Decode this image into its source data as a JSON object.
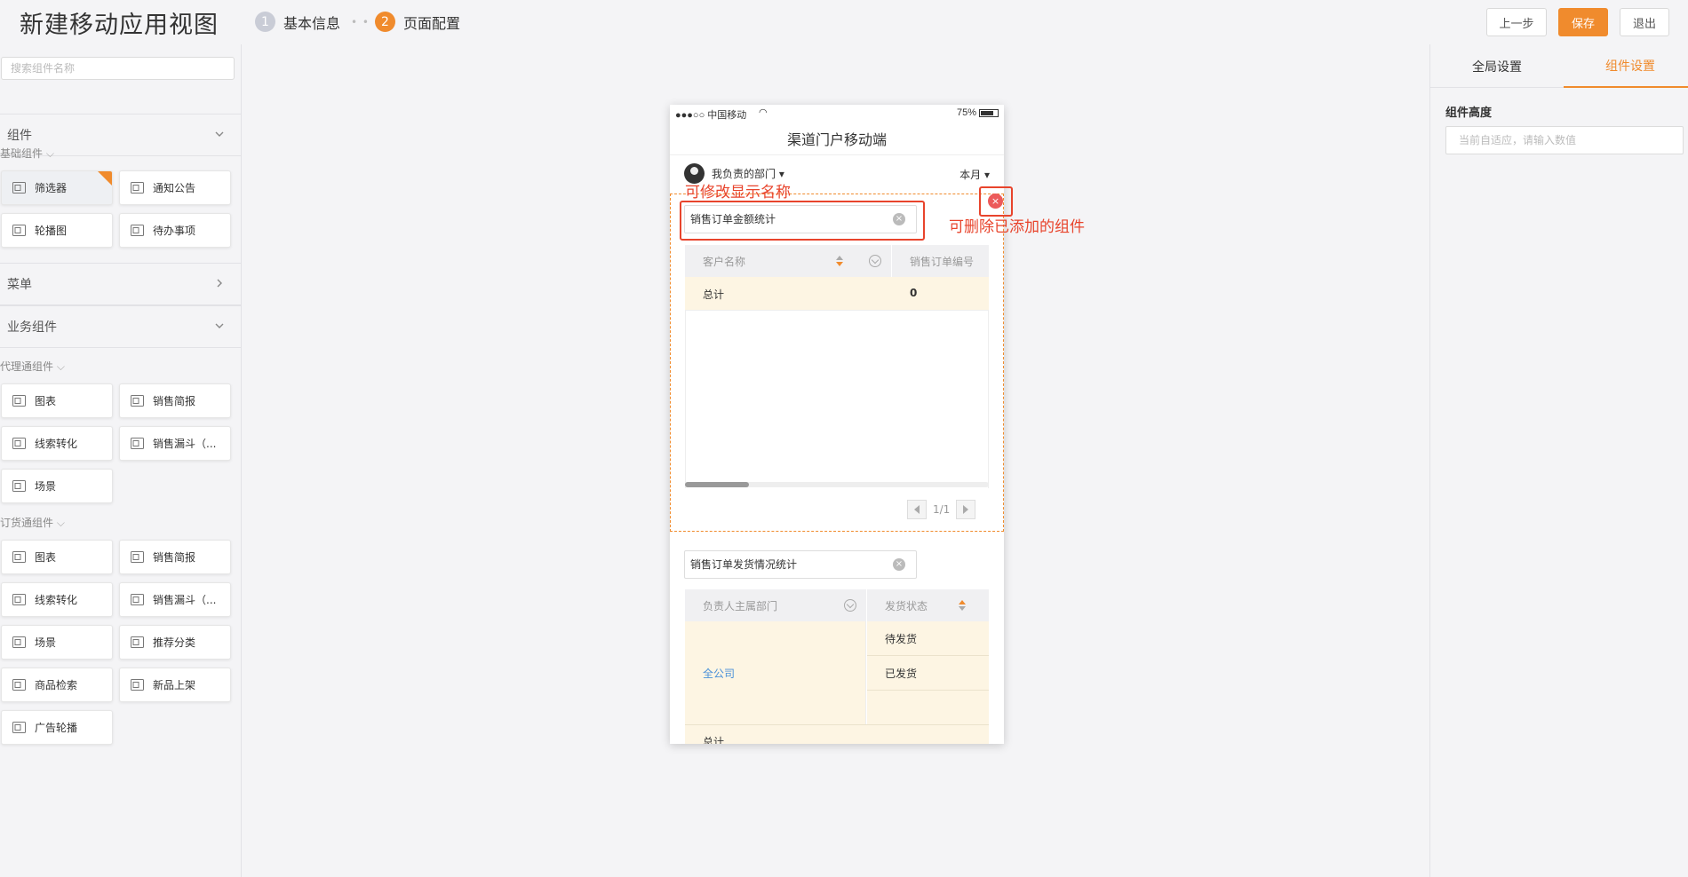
{
  "header": {
    "title": "新建移动应用视图",
    "steps": [
      {
        "num": "1",
        "label": "基本信息"
      },
      {
        "num": "2",
        "label": "页面配置"
      }
    ],
    "buttons": {
      "prev": "上一步",
      "save": "保存",
      "exit": "退出"
    }
  },
  "sidebar": {
    "search_placeholder": "搜索组件名称",
    "sections": {
      "components": "组件",
      "menu": "菜单",
      "business": "业务组件"
    },
    "groups": {
      "basic": "基础组件",
      "agent": "代理通组件",
      "order": "订货通组件"
    },
    "basic_items": [
      "筛选器",
      "通知公告",
      "轮播图",
      "待办事项"
    ],
    "agent_items": [
      "图表",
      "销售简报",
      "线索转化",
      "销售漏斗（...",
      "场景"
    ],
    "order_items": [
      "图表",
      "销售简报",
      "线索转化",
      "销售漏斗（...",
      "场景",
      "推荐分类",
      "商品检索",
      "新品上架",
      "广告轮播"
    ]
  },
  "phone": {
    "status": {
      "carrier": "●●●○○ 中国移动",
      "battery": "75%"
    },
    "title": "渠道门户移动端",
    "dept": "我负责的部门 ▾",
    "period": "本月 ▾",
    "widget1": {
      "name": "销售订单金额统计",
      "col1": "客户名称",
      "col2": "销售订单编号",
      "total_label": "总计",
      "total_value": "0",
      "page": "1/1"
    },
    "widget2": {
      "name": "销售订单发货情况统计",
      "col1": "负责人主属部门",
      "col2": "发货状态",
      "dept_value": "全公司",
      "status1": "待发货",
      "status2": "已发货",
      "total_label": "总计"
    }
  },
  "annotations": {
    "rename": "可修改显示名称",
    "delete": "可删除已添加的组件"
  },
  "rpanel": {
    "tab_global": "全局设置",
    "tab_component": "组件设置",
    "height_label": "组件高度",
    "height_placeholder": "当前自适应，请输入数值"
  },
  "colors": {
    "accent": "#f08b2d",
    "annotation": "#e8442c"
  }
}
